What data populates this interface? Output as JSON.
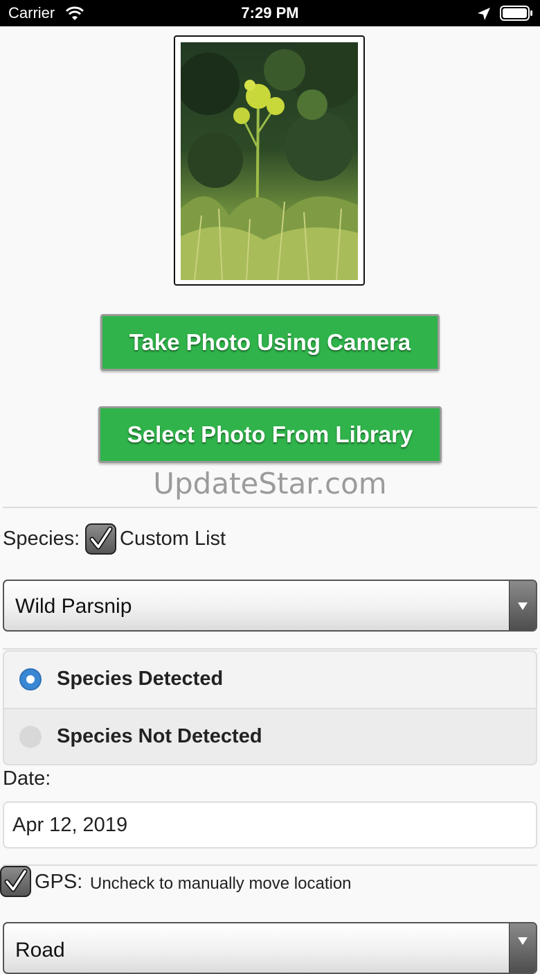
{
  "status_bar": {
    "carrier": "Carrier",
    "time": "7:29 PM",
    "icons": [
      "wifi-icon",
      "location-arrow-icon",
      "battery-icon"
    ]
  },
  "photo": {
    "icon": "plant-photo"
  },
  "buttons": {
    "camera_label": "Take Photo Using Camera",
    "library_label": "Select Photo From Library",
    "color": "#2fb34a"
  },
  "watermark": "UpdateStar.com",
  "species": {
    "label": "Species:",
    "custom_list_label": "Custom List",
    "custom_list_checked": true,
    "selected": "Wild Parsnip"
  },
  "detection": {
    "options": [
      {
        "label": "Species Detected",
        "selected": true
      },
      {
        "label": "Species Not Detected",
        "selected": false
      }
    ],
    "accent": "#3a87d4"
  },
  "date": {
    "label": "Date:",
    "value": "Apr 12, 2019"
  },
  "gps": {
    "label": "GPS:",
    "hint": "Uncheck to manually move location",
    "checked": true
  },
  "location_type": {
    "selected": "Road"
  }
}
